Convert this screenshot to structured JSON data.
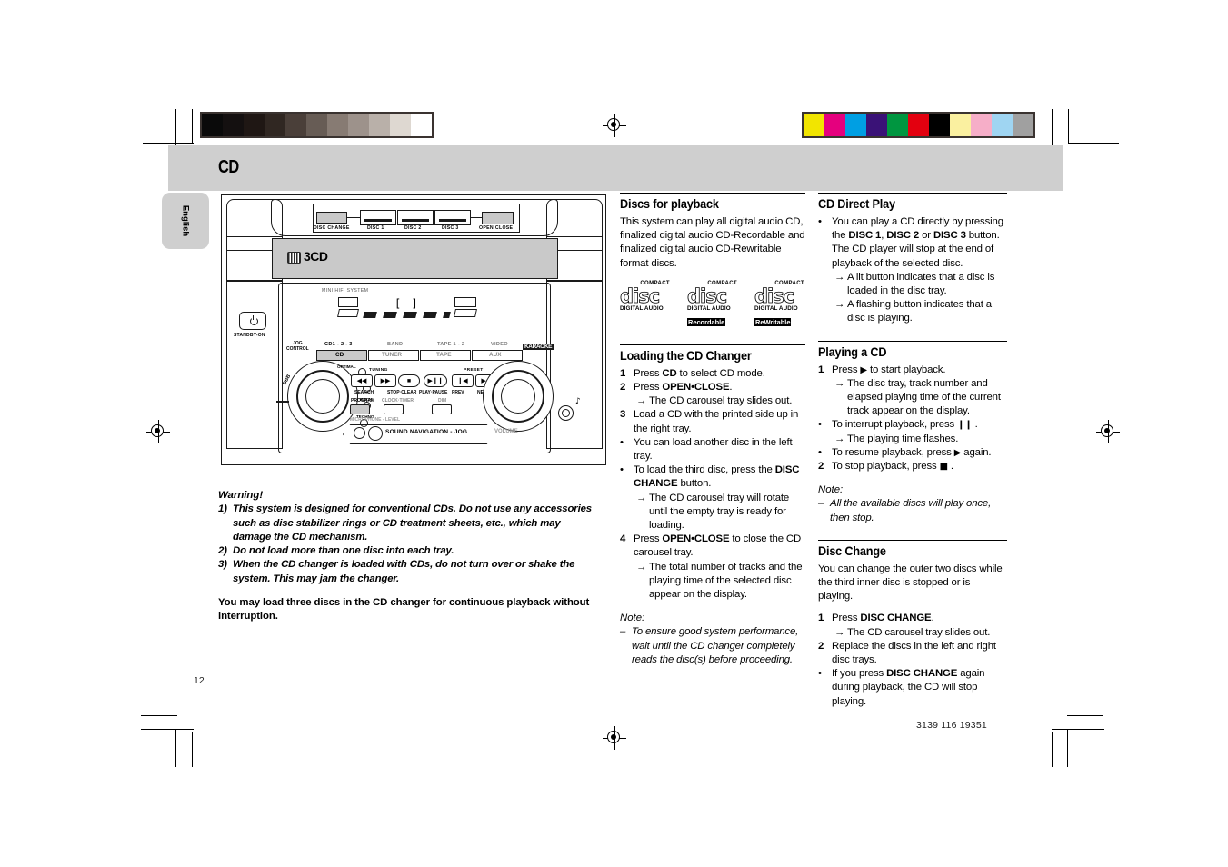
{
  "document": {
    "chapter_title": "CD",
    "language_tab": "English",
    "page_number": "12",
    "doc_number": "3139 116 19351"
  },
  "device_illustration": {
    "top_buttons": [
      "DISC CHANGE",
      "DISC 1",
      "DISC 2",
      "DISC 3",
      "OPEN·CLOSE"
    ],
    "changer_badge": "3CD",
    "system_label": "MINI HIFI SYSTEM",
    "standby_label": "STANDBY-ON",
    "jog_control_label": "JOG\nCONTROL",
    "source_labels_top": [
      "CD1 - 2 - 3",
      "BAND",
      "TAPE 1 - 2",
      "VIDEO"
    ],
    "source_buttons": [
      "CD",
      "TUNER",
      "TAPE",
      "AUX"
    ],
    "brand_badge": "KARAOKE",
    "tuning_label": "TUNING",
    "preset_label": "PRESET",
    "transport_labels": [
      "SEARCH",
      "STOP·CLEAR",
      "PLAY·PAUSE",
      "PREV",
      "NEXT"
    ],
    "secondary_buttons": [
      "PROGRAM",
      "CLOCK·TIMER",
      "DIM"
    ],
    "mic_label": "MICROPHONE - LEVEL",
    "jog_band": "SOUND NAVIGATION - JOG",
    "volume_label": "VOLUME",
    "dbb_label": "DBB",
    "dsc_presets": [
      "OPTIMAL",
      "JAZZ",
      "ROCK",
      "TECHNO"
    ]
  },
  "warning": {
    "title": "Warning!",
    "items": [
      {
        "num": "1)",
        "text": "This system is designed for conventional CDs. Do not use any accessories such as disc stabilizer rings or CD treatment sheets, etc., which may damage the CD mechanism."
      },
      {
        "num": "2)",
        "text": "Do not load more than one disc into each tray."
      },
      {
        "num": "3)",
        "text": "When the CD changer is loaded with CDs, do not turn over or shake the system. This may jam the changer."
      }
    ],
    "closing": "You may load three discs in the CD changer for continuous playback without interruption."
  },
  "sections": {
    "discs_for_playback": {
      "heading": "Discs for playback",
      "body": "This system can play all digital audio CD, finalized digital audio CD-Recordable and finalized digital audio CD-Rewritable format discs.",
      "logos": [
        {
          "top": "COMPACT",
          "word": "disc",
          "audio": "DIGITAL AUDIO",
          "tag": ""
        },
        {
          "top": "COMPACT",
          "word": "disc",
          "audio": "DIGITAL AUDIO",
          "tag": "Recordable"
        },
        {
          "top": "COMPACT",
          "word": "disc",
          "audio": "DIGITAL AUDIO",
          "tag": "ReWritable"
        }
      ]
    },
    "loading_the_cd_changer": {
      "heading": "Loading the CD Changer",
      "steps": [
        {
          "mark": "1",
          "type": "num",
          "html": "Press <b>CD</b> to select CD mode."
        },
        {
          "mark": "2",
          "type": "num",
          "html": "Press <b>OPEN•CLOSE</b>."
        },
        {
          "mark": "→",
          "type": "sub",
          "html": "The CD carousel tray slides out."
        },
        {
          "mark": "3",
          "type": "num",
          "html": "Load a CD with the printed side up in the right tray."
        },
        {
          "mark": "•",
          "type": "bul",
          "html": "You can load another disc in the left tray."
        },
        {
          "mark": "•",
          "type": "bul",
          "html": "To load the third disc, press the <b>DISC CHANGE</b> button."
        },
        {
          "mark": "→",
          "type": "sub",
          "html": "The CD carousel tray will rotate until the empty tray is ready for loading."
        },
        {
          "mark": "4",
          "type": "num",
          "html": "Press <b>OPEN•CLOSE</b> to close the CD carousel tray."
        },
        {
          "mark": "→",
          "type": "sub",
          "html": "The total number of tracks and the playing time of the selected disc appear on the display."
        }
      ],
      "note_label": "Note:",
      "notes": [
        {
          "mark": "–",
          "html": "To ensure good system performance, wait until the CD changer completely reads the disc(s) before proceeding."
        }
      ]
    },
    "cd_direct_play": {
      "heading": "CD Direct Play",
      "steps": [
        {
          "mark": "•",
          "type": "bul",
          "html": "You can play a CD directly by pressing the <b>DISC 1</b>, <b>DISC 2</b> or <b>DISC 3</b> button. The CD player will stop at the end of playback of the selected disc."
        },
        {
          "mark": "→",
          "type": "sub",
          "html": "A lit button indicates that a disc is loaded in the disc tray."
        },
        {
          "mark": "→",
          "type": "sub",
          "html": "A flashing button indicates that a disc is playing."
        }
      ]
    },
    "playing_a_cd": {
      "heading": "Playing a CD",
      "steps": [
        {
          "mark": "1",
          "type": "num",
          "html": "Press <span class=\"glyph\">▶</span> to start playback."
        },
        {
          "mark": "→",
          "type": "sub",
          "html": "The disc tray, track number and elapsed playing time of the current track appear on the display."
        },
        {
          "mark": "•",
          "type": "bul",
          "html": "To interrupt playback, press <span class=\"glyph\">❙❙</span> ."
        },
        {
          "mark": "→",
          "type": "sub",
          "html": "The playing time flashes."
        },
        {
          "mark": "•",
          "type": "bul",
          "html": "To resume playback, press <span class=\"glyph\">▶</span> again."
        },
        {
          "mark": "2",
          "type": "num",
          "html": "To stop playback, press <span class=\"glyph\">■</span> ."
        }
      ],
      "note_label": "Note:",
      "notes": [
        {
          "mark": "–",
          "html": "All the available discs will play once, then stop."
        }
      ]
    },
    "disc_change": {
      "heading": "Disc Change",
      "body": "You can change the outer two discs while the third inner disc is stopped or is playing.",
      "steps": [
        {
          "mark": "1",
          "type": "num",
          "html": "Press <b>DISC CHANGE</b>."
        },
        {
          "mark": "→",
          "type": "sub",
          "html": "The CD carousel tray slides out."
        },
        {
          "mark": "2",
          "type": "num",
          "html": "Replace the discs in the left and right disc trays."
        },
        {
          "mark": "•",
          "type": "bul",
          "html": "If you press <b>DISC CHANGE</b> again during playback, the CD will stop playing."
        }
      ]
    }
  },
  "print_marks": {
    "grayscale_swatches": [
      "#0a0a0a",
      "#141010",
      "#1f1714",
      "#302722",
      "#4a3f39",
      "#675c55",
      "#877b73",
      "#9d928b",
      "#b9b0a9",
      "#ded8d1",
      "#ffffff"
    ],
    "color_swatches": [
      "#f2e500",
      "#e5007e",
      "#009fe3",
      "#3a1277",
      "#009640",
      "#e3000f",
      "#000000",
      "#faf0a0",
      "#f6aec8",
      "#9fd5f2",
      "#a0a0a0"
    ]
  }
}
